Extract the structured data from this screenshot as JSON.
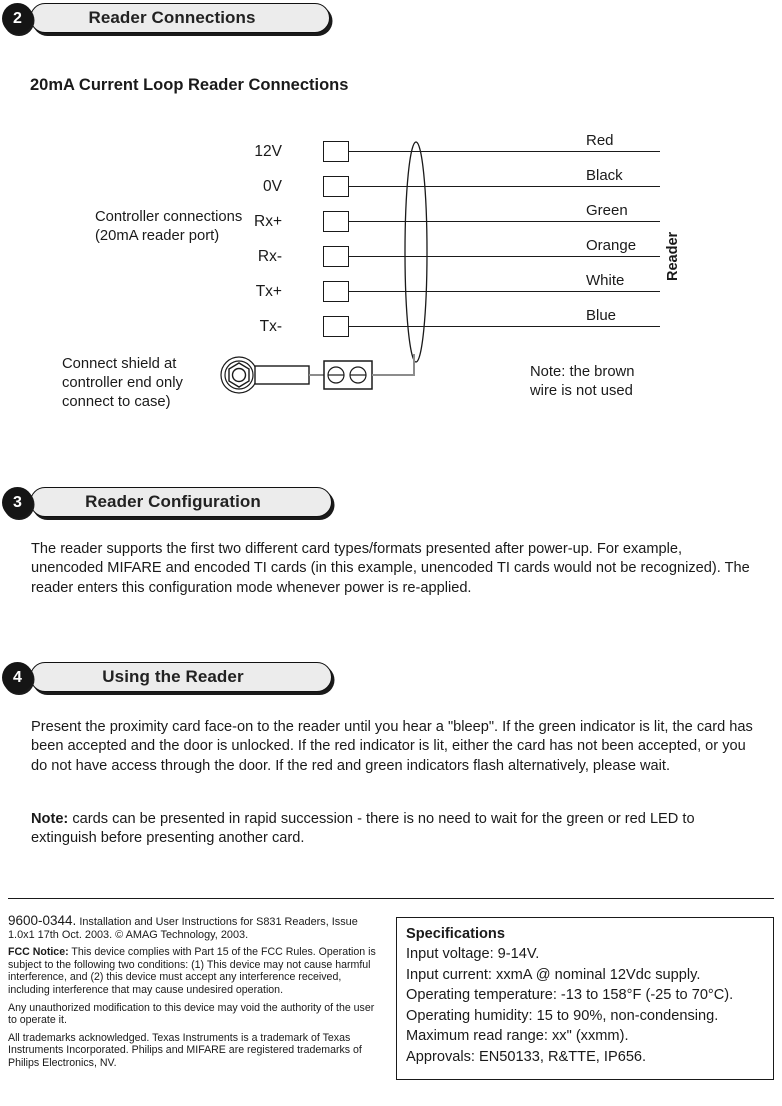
{
  "sections": [
    {
      "number": "2",
      "title": "Reader Connections"
    },
    {
      "number": "3",
      "title": "Reader Configuration"
    },
    {
      "number": "4",
      "title": "Using the Reader"
    }
  ],
  "diagram": {
    "subtitle": "20mA Current Loop Reader Connections",
    "controller_caption": "Controller connections\n(20mA reader port)",
    "shield_caption": "Connect shield at\ncontroller end only\nconnect to case)",
    "reader_label": "Reader",
    "note": "Note: the brown\nwire is not used",
    "terminals": [
      {
        "name": "12V",
        "wire_color": "Red"
      },
      {
        "name": "0V",
        "wire_color": "Black"
      },
      {
        "name": "Rx+",
        "wire_color": "Green"
      },
      {
        "name": "Rx-",
        "wire_color": "Orange"
      },
      {
        "name": "Tx+",
        "wire_color": "White"
      },
      {
        "name": "Tx-",
        "wire_color": "Blue"
      }
    ]
  },
  "configuration": {
    "paragraph": "The reader supports the first two different card types/formats presented after power-up. For example, unencoded MIFARE and encoded TI cards (in this example, unencoded TI cards would not be recognized). The reader enters this configuration mode whenever power is re-applied."
  },
  "usage": {
    "paragraph": "Present the proximity card face-on to the reader until you hear a \"bleep\". If the green indicator is lit, the card has been accepted and the door is unlocked. If the red indicator is lit, either the card has not been accepted, or you do not have access through the door. If the red and green indicators flash alternatively, please wait.",
    "note_label": "Note:",
    "note_text": " cards can be presented in rapid succession - there is no need to wait for the green or red LED to extinguish before presenting another card."
  },
  "footer": {
    "doc_number": "9600-0344.",
    "doc_info": " Installation and User Instructions for S831 Readers, Issue 1.0x1 17th Oct. 2003. © AMAG Technology, 2003.",
    "fcc_label": "FCC Notice:",
    "fcc_text": " This device complies with Part 15 of the FCC Rules. Operation is subject to the following two conditions: (1) This device may not cause harmful interference, and (2) this device must accept any interference received, including interference that may cause undesired operation.",
    "modification_text": "Any unauthorized modification to this device may void the authority of the user to operate it.",
    "trademark_text": "All trademarks acknowledged. Texas Instruments is a trademark of Texas Instruments Incorporated. Philips and MIFARE are registered trademarks of Philips Electronics, NV."
  },
  "specifications": {
    "title": "Specifications",
    "lines": [
      "Input voltage: 9-14V.",
      "Input current: xxmA @ nominal 12Vdc supply.",
      "Operating temperature: -13 to 158°F (-25 to 70°C).",
      "Operating humidity: 15 to 90%, non-condensing.",
      "Maximum read range: xx\" (xxmm).",
      "Approvals: EN50133, R&TTE, IP656."
    ]
  }
}
